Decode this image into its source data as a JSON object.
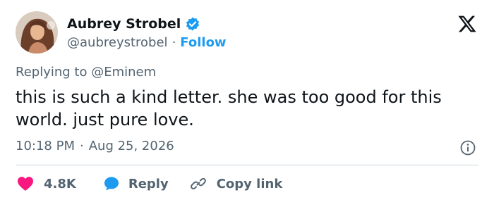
{
  "author": {
    "display_name": "Aubrey Strobel",
    "handle": "@aubreystrobel",
    "separator": "·",
    "follow_label": "Follow",
    "verified": true
  },
  "reply_to": {
    "prefix": "Replying to",
    "mention": "@Eminem"
  },
  "tweet": {
    "text": "this is such a kind letter. she was too good for this world. just pure love."
  },
  "meta": {
    "time": "10:18 PM",
    "separator": "·",
    "date": "Aug 25, 2026"
  },
  "actions": {
    "like_count": "4.8K",
    "reply_label": "Reply",
    "copy_label": "Copy link"
  },
  "icons": {
    "verified": "verified-badge-icon",
    "brand": "x-logo-icon",
    "info": "info-icon",
    "like": "heart-icon",
    "reply": "speech-bubble-icon",
    "copy": "link-icon"
  },
  "colors": {
    "accent": "#1d9bf0",
    "like": "#f91880",
    "text": "#0f1419",
    "muted": "#536471",
    "divider": "#cfd9de"
  }
}
